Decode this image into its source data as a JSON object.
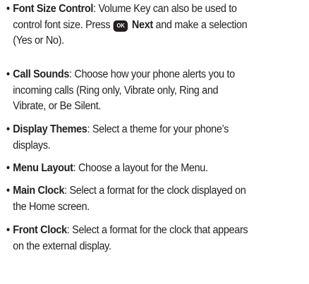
{
  "items": [
    {
      "term": "Font Size Control",
      "lines": [
        ": Volume Key can also be used to",
        "control font size. Press ",
        " and make a selection",
        "(Yes or No)."
      ],
      "key_label": "OK",
      "key_action": "Next"
    },
    {
      "term": "Call Sounds",
      "lines": [
        ": Choose how your phone alerts you to",
        "incoming calls (Ring only, Vibrate only, Ring and",
        "Vibrate, or Be Silent."
      ]
    },
    {
      "term": "Display Themes",
      "lines": [
        ": Select a theme for your phone’s",
        "displays."
      ]
    },
    {
      "term": "Menu Layout",
      "lines": [
        ": Choose a layout for the Menu."
      ]
    },
    {
      "term": "Main Clock",
      "lines": [
        ": Select a format for the clock displayed on",
        "the Home screen."
      ]
    },
    {
      "term": "Front Clock",
      "lines": [
        ": Select a format for the clock that appears",
        "on the external display."
      ]
    }
  ],
  "bullet": "•"
}
